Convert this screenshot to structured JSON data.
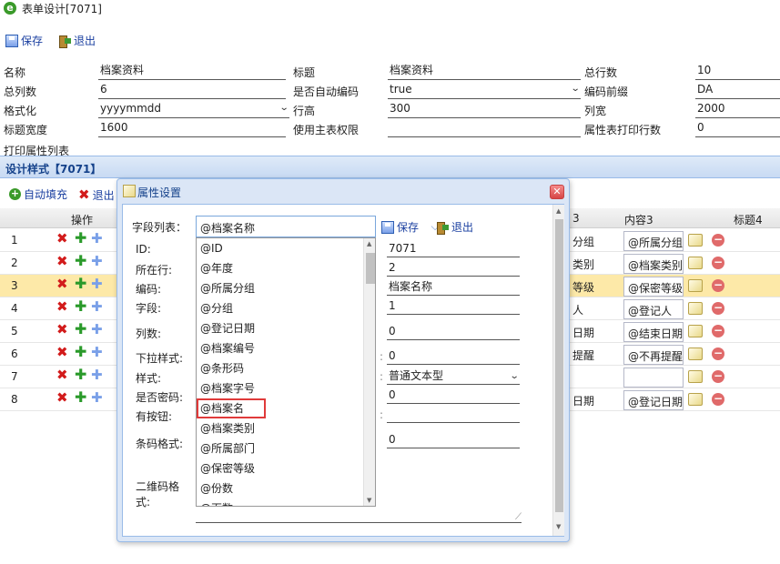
{
  "window": {
    "title": "表单设计[7071]",
    "app_icon": "ie-icon"
  },
  "toolbar": {
    "save_label": "保存",
    "exit_label": "退出"
  },
  "form": {
    "name_label": "名称",
    "name_value": "档案资料",
    "title_label": "标题",
    "title_value": "档案资料",
    "total_rows_label": "总行数",
    "total_rows_value": "10",
    "total_cols_label": "总列数",
    "total_cols_value": "6",
    "auto_code_label": "是否自动编码",
    "auto_code_value": "true",
    "code_prefix_label": "编码前缀",
    "code_prefix_value": "DA",
    "format_label": "格式化",
    "format_value": "yyyymmdd",
    "row_height_label": "行高",
    "row_height_value": "300",
    "col_width_label": "列宽",
    "col_width_value": "2000",
    "title_width_label": "标题宽度",
    "title_width_value": "1600",
    "main_perm_label": "使用主表权限",
    "main_perm_value": "",
    "attr_print_label": "属性表打印行数",
    "attr_print_value": "0",
    "print_attr_list_label": "打印属性列表"
  },
  "design": {
    "header": "设计样式【7071】",
    "auto_fill_label": "自动填充",
    "exit_label": "退出",
    "columns": {
      "op": "操作",
      "c3": "3",
      "content3": "内容3",
      "title4": "标题4"
    },
    "rows": [
      {
        "num": "1",
        "c3": "分组",
        "content3": "@所属分组"
      },
      {
        "num": "2",
        "c3": "类别",
        "content3": "@档案类别"
      },
      {
        "num": "3",
        "c3": "等级",
        "content3": "@保密等级"
      },
      {
        "num": "4",
        "c3": "人",
        "content3": "@登记人"
      },
      {
        "num": "5",
        "c3": "日期",
        "content3": "@结束日期"
      },
      {
        "num": "6",
        "c3": "提醒",
        "content3": "@不再提醒"
      },
      {
        "num": "7",
        "c3": "",
        "content3": ""
      },
      {
        "num": "8",
        "c3": "日期",
        "content3": "@登记日期"
      }
    ]
  },
  "dialog": {
    "title": "属性设置",
    "field_list_label": "字段列表：",
    "field_list_value": "@档案名称",
    "save_label": "保存",
    "exit_label": "退出",
    "labels": {
      "id": "ID:",
      "row": "所在行:",
      "code": "编码:",
      "field": "字段:",
      "col_count": "列数:",
      "dropdown_style": "下拉样式:",
      "style": "样式:",
      "is_password": "是否密码:",
      "has_button": "有按钮:",
      "barcode_format": "条码格式:",
      "qrcode_format": "二维码格式:"
    },
    "values": {
      "id": "7071",
      "row": "2",
      "code": "档案名称",
      "field": "1",
      "col_count": "0",
      "dropdown_style": "0",
      "style": "普通文本型",
      "is_password": "0",
      "has_button": "",
      "barcode_format": "0"
    },
    "options": [
      "@ID",
      "@年度",
      "@所属分组",
      "@分组",
      "@登记日期",
      "@档案编号",
      "@条形码",
      "@档案字号",
      "@档案名",
      "@档案类别",
      "@所属部门",
      "@保密等级",
      "@份数",
      "@页数"
    ],
    "highlighted_option": "@档案名"
  }
}
